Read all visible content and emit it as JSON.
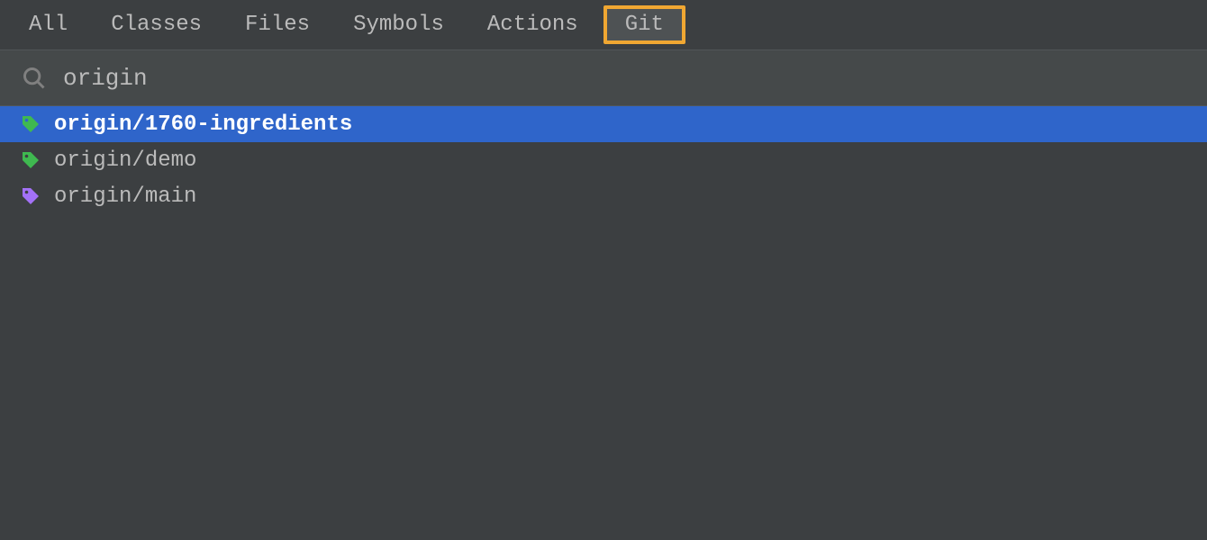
{
  "tabs": [
    {
      "label": "All",
      "active": false
    },
    {
      "label": "Classes",
      "active": false
    },
    {
      "label": "Files",
      "active": false
    },
    {
      "label": "Symbols",
      "active": false
    },
    {
      "label": "Actions",
      "active": false
    },
    {
      "label": "Git",
      "active": true
    }
  ],
  "search": {
    "value": "origin"
  },
  "results": [
    {
      "label": "origin/1760-ingredients",
      "selected": true,
      "icon_color": "#3fb950"
    },
    {
      "label": "origin/demo",
      "selected": false,
      "icon_color": "#3fb950"
    },
    {
      "label": "origin/main",
      "selected": false,
      "icon_color": "#a371f7"
    }
  ],
  "colors": {
    "highlight_border": "#f0a732",
    "selection_bg": "#2f65ca"
  }
}
